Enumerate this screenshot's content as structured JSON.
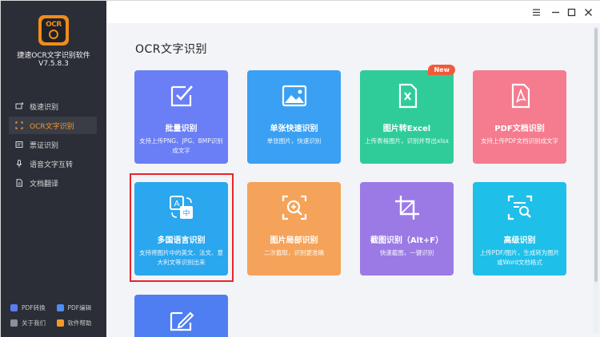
{
  "app": {
    "logo_text": "OCR",
    "name": "捷速OCR文字识别软件",
    "version": "V7.5.8.3"
  },
  "sidebar": {
    "items": [
      {
        "label": "极速识别",
        "icon": "screen-rotate-icon",
        "active": false
      },
      {
        "label": "OCR文字识别",
        "icon": "scan-icon",
        "active": true
      },
      {
        "label": "票证识别",
        "icon": "ticket-icon",
        "active": false
      },
      {
        "label": "语音文字互转",
        "icon": "microphone-icon",
        "active": false
      },
      {
        "label": "文档翻译",
        "icon": "document-icon",
        "active": false
      }
    ],
    "bottom_links": [
      {
        "label": "PDF转换",
        "color": "#5b7cfa"
      },
      {
        "label": "PDF编辑",
        "color": "#4c8df6"
      },
      {
        "label": "关于我们",
        "color": "#8a8f99"
      },
      {
        "label": "软件帮助",
        "color": "#f39a2a"
      }
    ]
  },
  "main": {
    "title": "OCR文字识别",
    "cards": [
      {
        "title": "批量识别",
        "desc": "支持上传PNG、JPG、BMP识别成文字",
        "color": "#6a7ef6"
      },
      {
        "title": "单张快速识别",
        "desc": "单张图片，快速识别",
        "color": "#3aa0f3"
      },
      {
        "title": "图片转Excel",
        "desc": "上传表格图片，识别并导出xlsx",
        "color": "#2fcc9a",
        "badge": "New"
      },
      {
        "title": "PDF文档识别",
        "desc": "支持上传PDF文档识别成文字",
        "color": "#f57b8f"
      },
      {
        "title": "多国语言识别",
        "desc": "支持将图片中的英文、法文、意大利文等识别出来",
        "color": "#2aa7ee"
      },
      {
        "title": "图片局部识别",
        "desc": "二次截取，识别更准确",
        "color": "#f5a35a"
      },
      {
        "title": "截图识别（Alt+F）",
        "desc": "快速截图，一键识别",
        "color": "#9b7ae6"
      },
      {
        "title": "高级识别",
        "desc": "上传PDF/图片，生成转为图片或Word文档格式",
        "color": "#1ec0ea"
      }
    ]
  },
  "colors": {
    "sidebar_bg": "#2b2e36",
    "accent": "#f39a2a",
    "highlight": "#e8242b"
  }
}
